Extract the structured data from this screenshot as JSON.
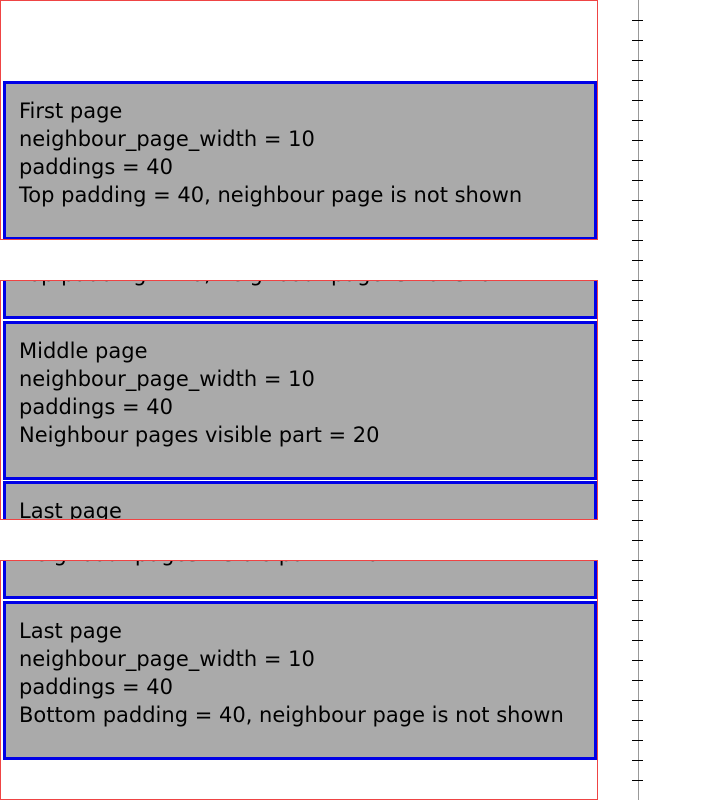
{
  "colors": {
    "viewport_border": "#ef4444",
    "page_border": "#0000e6",
    "page_fill": "#aaaaaa",
    "ruler": "#999999"
  },
  "pages": {
    "first": {
      "title": "First page",
      "width_line": "neighbour_page_width = 10",
      "paddings_line": "paddings = 40",
      "note": "Top padding = 40, neighbour page is not shown"
    },
    "middle": {
      "title": "Middle page",
      "width_line": "neighbour_page_width = 10",
      "paddings_line": "paddings = 40",
      "note": "Neighbour pages visible part = 20"
    },
    "last": {
      "title": "Last page",
      "width_line": "neighbour_page_width = 10",
      "paddings_line": "paddings = 40",
      "note": "Bottom padding = 40, neighbour page is not shown"
    }
  },
  "ruler": {
    "tick_count": 39
  }
}
